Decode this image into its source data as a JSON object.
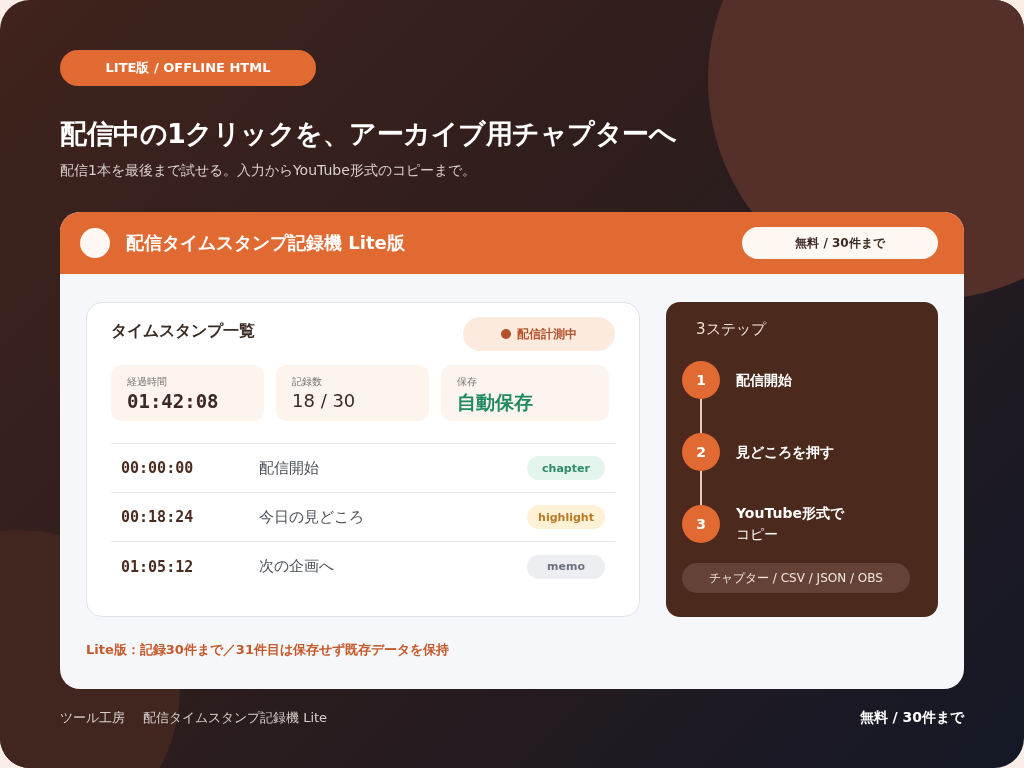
{
  "badge": "LITE版 / OFFLINE HTML",
  "headline": "配信中の1クリックを、アーカイブ用チャプターへ",
  "subtitle": "配信1本を最後まで試せる。入力からYouTube形式のコピーまで。",
  "app": {
    "title": "配信タイムスタンプ記録機 Lite版",
    "plan": "無料 / 30件まで",
    "list": {
      "title": "タイムスタンプ一覧",
      "status": "配信計測中",
      "stats": [
        {
          "label": "経過時間",
          "value": "01:42:08",
          "kind": "time"
        },
        {
          "label": "記録数",
          "value": "18 / 30",
          "kind": "count"
        },
        {
          "label": "保存",
          "value": "自動保存",
          "kind": "status"
        }
      ],
      "rows": [
        {
          "time": "00:00:00",
          "title": "配信開始",
          "tag": "chapter",
          "kind": "chapter"
        },
        {
          "time": "00:18:24",
          "title": "今日の見どころ",
          "tag": "highlight",
          "kind": "highlight"
        },
        {
          "time": "01:05:12",
          "title": "次の企画へ",
          "tag": "memo",
          "kind": "memo"
        }
      ]
    },
    "steps": {
      "title": "3ステップ",
      "items": [
        {
          "number": "1",
          "lines": [
            "配信開始"
          ]
        },
        {
          "number": "2",
          "lines": [
            "見どころを押す"
          ]
        },
        {
          "number": "3",
          "lines": [
            "YouTube形式で",
            "コピー"
          ]
        }
      ],
      "formats": "チャプター / CSV / JSON / OBS"
    },
    "note": "Lite版：記録30件まで／31件目は保存せず既存データを保持"
  },
  "footer": {
    "brand": "ツール工房",
    "product": "配信タイムスタンプ記録機 Lite",
    "plan": "無料 / 30件まで"
  }
}
